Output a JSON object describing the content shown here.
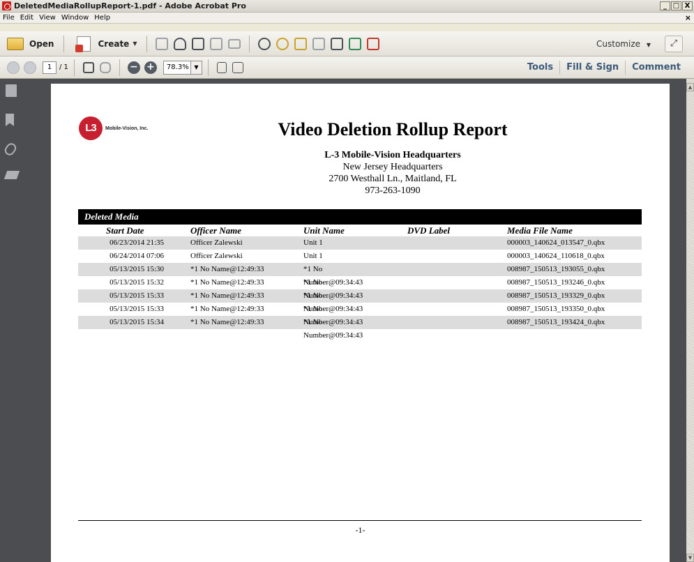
{
  "window": {
    "title": "DeletedMediaRollupReport-1.pdf - Adobe Acrobat Pro",
    "buttons": [
      "_",
      "□",
      "X"
    ]
  },
  "menu": {
    "items": [
      "File",
      "Edit",
      "View",
      "Window",
      "Help"
    ],
    "close": "×"
  },
  "toolbar": {
    "open_label": "Open",
    "create_label": "Create",
    "customize_label": "Customize",
    "icons": [
      "folder-icon",
      "create-icon",
      "save-icon",
      "cloud-upload-icon",
      "print-icon",
      "edit-icon",
      "email-icon",
      "settings-icon",
      "comment-icon",
      "highlight-icon",
      "document-icon",
      "document-search-icon",
      "export-icon",
      "redact-icon",
      "expand-icon"
    ]
  },
  "navbar": {
    "page_current": "1",
    "page_total": "/ 1",
    "zoom": "78.3%",
    "tools_label": "Tools",
    "fill_sign_label": "Fill & Sign",
    "comment_label": "Comment"
  },
  "report": {
    "logo_text": "Mobile-Vision, Inc.",
    "logo_mark": "L3",
    "title": "Video Deletion Rollup Report",
    "hq_name": "L-3 Mobile-Vision Headquarters",
    "hq_line2": "New Jersey Headquarters",
    "hq_line3": "2700 Westhall Ln., Maitland, FL",
    "hq_phone": "973-263-1090",
    "section_title": "Deleted Media",
    "columns": [
      "Start Date",
      "Officer Name",
      "Unit Name",
      "DVD Label",
      "Media File Name"
    ],
    "rows": [
      [
        "06/23/2014 21:35",
        "Officer Zalewski",
        "Unit 1",
        "",
        "000003_140624_013547_0.qbx"
      ],
      [
        "06/24/2014 07:06",
        "Officer Zalewski",
        "Unit 1",
        "",
        "000003_140624_110618_0.qbx"
      ],
      [
        "05/13/2015 15:30",
        "*1 No Name@12:49:33",
        "*1 No Number@09:34:43",
        "",
        "008987_150513_193055_0.qbx"
      ],
      [
        "05/13/2015 15:32",
        "*1 No Name@12:49:33",
        "*1 No Number@09:34:43",
        "",
        "008987_150513_193246_0.qbx"
      ],
      [
        "05/13/2015 15:33",
        "*1 No Name@12:49:33",
        "*1 No Number@09:34:43",
        "",
        "008987_150513_193329_0.qbx"
      ],
      [
        "05/13/2015 15:33",
        "*1 No Name@12:49:33",
        "*1 No Number@09:34:43",
        "",
        "008987_150513_193350_0.qbx"
      ],
      [
        "05/13/2015 15:34",
        "*1 No Name@12:49:33",
        "*1 No Number@09:34:43",
        "",
        "008987_150513_193424_0.qbx"
      ]
    ],
    "page_number": "-1-"
  }
}
